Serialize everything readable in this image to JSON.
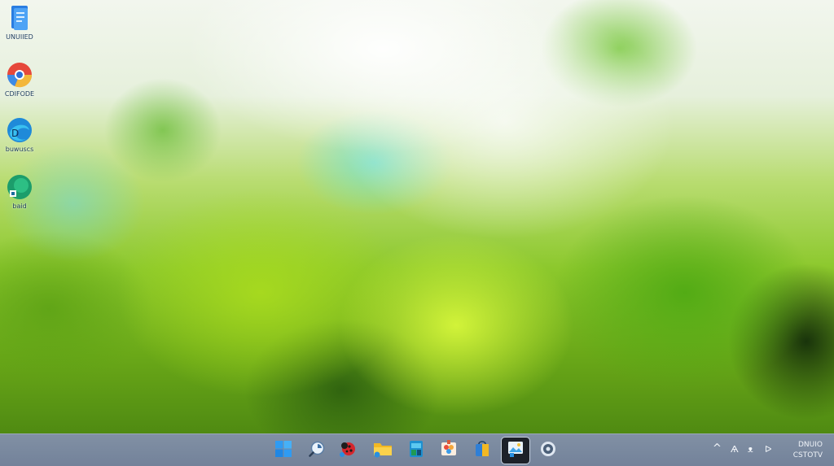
{
  "desktop": {
    "icons": [
      {
        "name": "desktop-icon-1",
        "label": "UNUIIED",
        "icon": "document-blue-icon"
      },
      {
        "name": "desktop-icon-2",
        "label": "CDIFODE",
        "icon": "app-circle-red-icon"
      },
      {
        "name": "desktop-icon-3",
        "label": "buwuscs",
        "icon": "edge-browser-icon"
      },
      {
        "name": "desktop-icon-4",
        "label": "baid",
        "icon": "green-circle-app-icon"
      }
    ]
  },
  "taskbar": {
    "apps": [
      {
        "name": "start-button",
        "icon": "windows-logo-icon"
      },
      {
        "name": "search-button",
        "icon": "search-icon"
      },
      {
        "name": "taskbar-app-ladybug",
        "icon": "ladybug-icon"
      },
      {
        "name": "file-explorer-button",
        "icon": "folder-icon"
      },
      {
        "name": "taskbar-app-store",
        "icon": "store-icon"
      },
      {
        "name": "taskbar-app-paint",
        "icon": "paint-icon"
      },
      {
        "name": "taskbar-app-bag",
        "icon": "bag-icon"
      },
      {
        "name": "taskbar-app-photos",
        "icon": "photos-icon",
        "active": true
      },
      {
        "name": "settings-button",
        "icon": "gear-icon"
      }
    ],
    "tray": {
      "chevron": "^",
      "network": "Ѧ",
      "volume": "ᴥ",
      "battery": "ᐅ"
    },
    "clock": {
      "time": "DNUIO",
      "date": "CSTOTV"
    }
  }
}
